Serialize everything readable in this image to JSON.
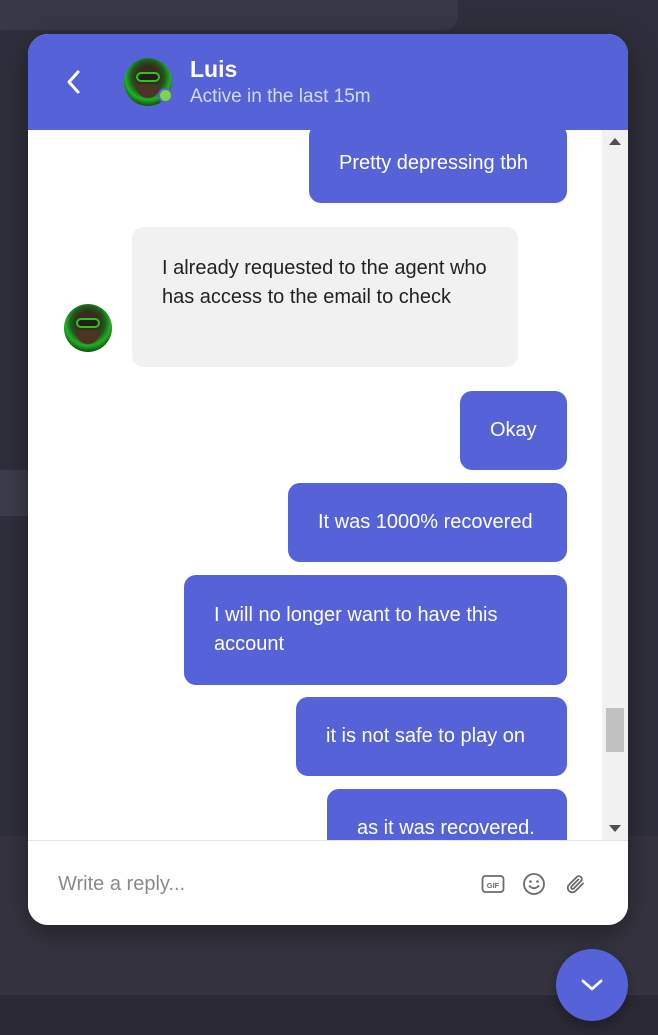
{
  "header": {
    "name": "Luis",
    "status": "Active in the last 15m"
  },
  "messages": [
    {
      "direction": "out",
      "text": "Pretty depressing tbh"
    },
    {
      "direction": "in",
      "text": "I already requested to the agent who has access to the email to check"
    },
    {
      "direction": "out",
      "text": "Okay"
    },
    {
      "direction": "out",
      "text": "It was 1000% recovered"
    },
    {
      "direction": "out",
      "text": "I will no longer want to have this account"
    },
    {
      "direction": "out",
      "text": "it is not safe to play on"
    },
    {
      "direction": "out",
      "text": "as it was recovered."
    }
  ],
  "composer": {
    "placeholder": "Write a reply..."
  },
  "icons": {
    "back": "chevron-left-icon",
    "gif": "gif-icon",
    "emoji": "emoji-icon",
    "attach": "paperclip-icon",
    "scroll_down": "chevron-down-icon"
  },
  "colors": {
    "accent": "#5662d8",
    "incoming_bubble": "#f1f1f1",
    "online": "#7fd349"
  }
}
